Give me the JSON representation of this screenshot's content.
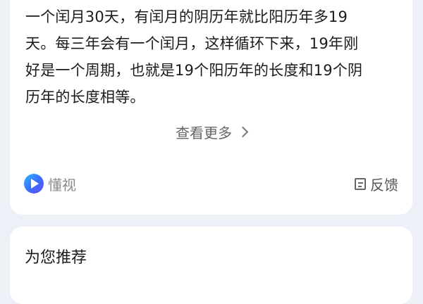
{
  "answer": {
    "lines": [
      "一个闰月30天，有闰月的阴历年就比阳历年多19",
      "天。每三年会有一个闰月，这样循环下来，19年刚",
      "好是一个周期，也就是19个阳历年的长度和19个阴",
      "历年的长度相等。"
    ],
    "more_label": "查看更多",
    "source_label": "懂视",
    "feedback_label": "反馈"
  },
  "recommend": {
    "title": "为您推荐"
  }
}
